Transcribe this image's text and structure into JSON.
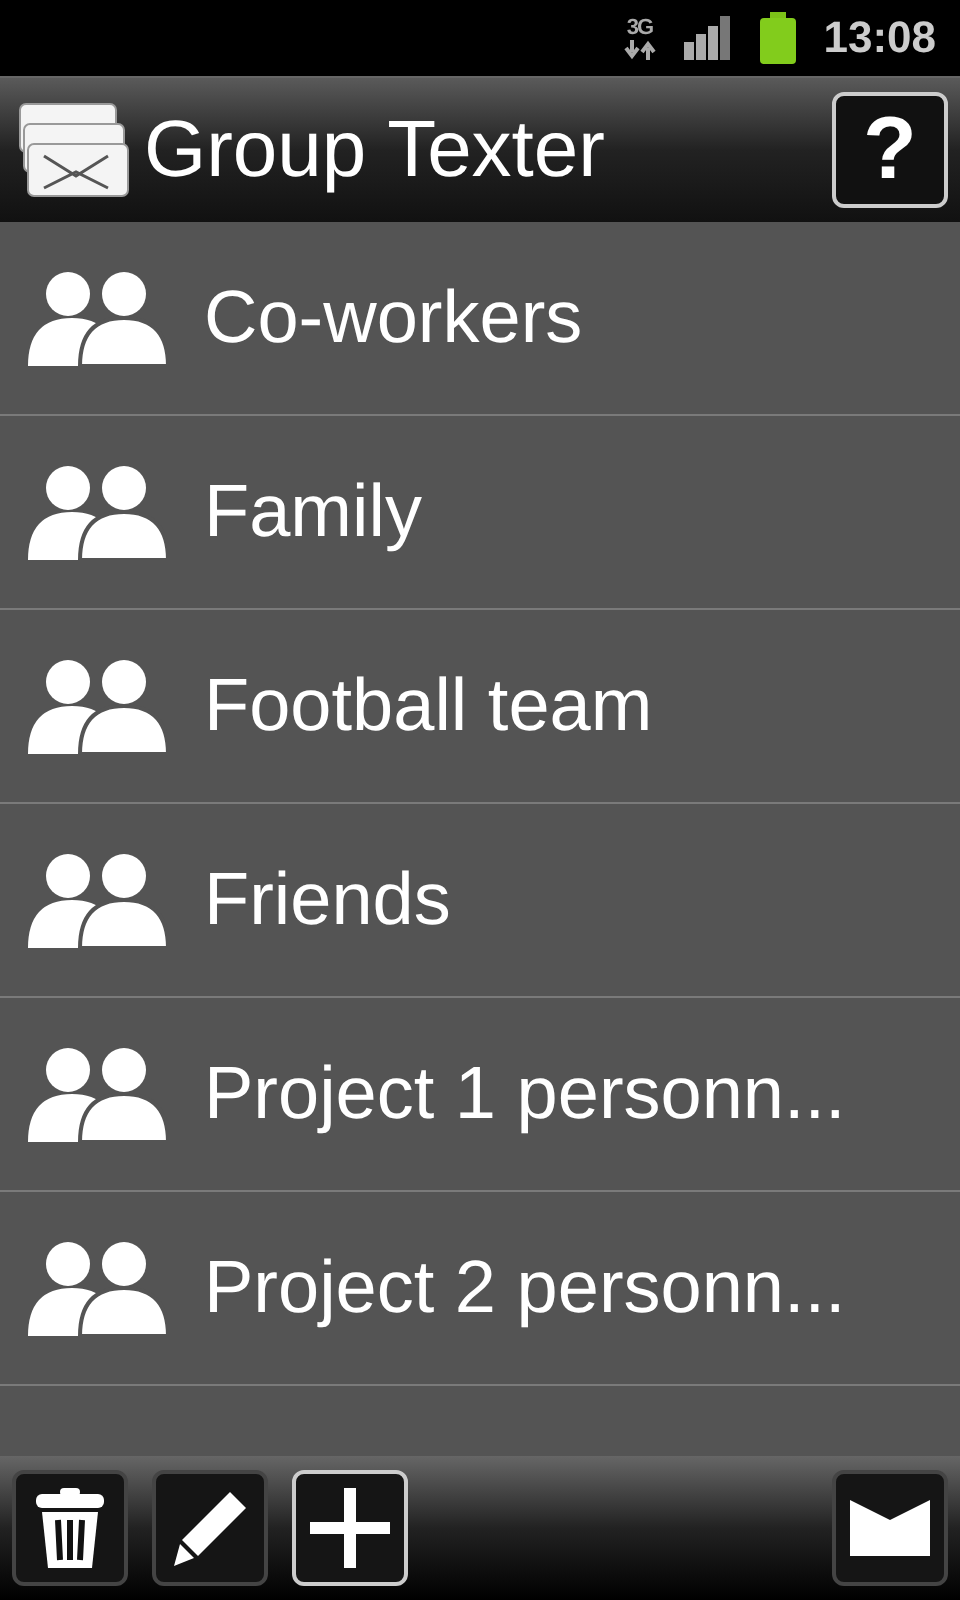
{
  "status_bar": {
    "network": "3G",
    "time": "13:08"
  },
  "title_bar": {
    "title": "Group Texter",
    "help_button": "?"
  },
  "groups": [
    {
      "name": "Co-workers"
    },
    {
      "name": "Family"
    },
    {
      "name": "Football team"
    },
    {
      "name": "Friends"
    },
    {
      "name": "Project 1 personn..."
    },
    {
      "name": "Project 2 personn..."
    }
  ],
  "toolbar": [
    {
      "kind": "delete",
      "focused": false
    },
    {
      "kind": "edit",
      "focused": false
    },
    {
      "kind": "add",
      "focused": true
    },
    {
      "kind": "send",
      "focused": false
    }
  ]
}
